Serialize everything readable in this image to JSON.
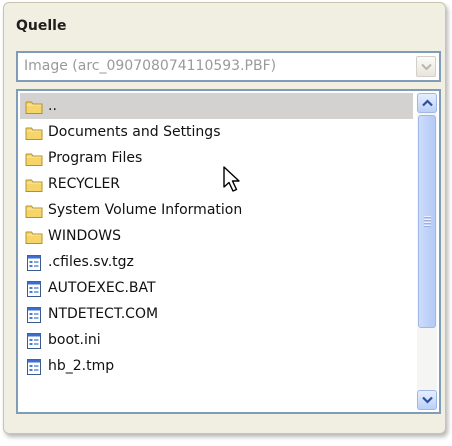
{
  "source_group": {
    "title": "Quelle",
    "combo_value": "Image (arc_090708074110593.PBF)"
  },
  "file_list": {
    "items": [
      {
        "label": "..",
        "icon": "folder-icon",
        "selected": true
      },
      {
        "label": "Documents and Settings",
        "icon": "folder-icon"
      },
      {
        "label": "Program Files",
        "icon": "folder-icon"
      },
      {
        "label": "RECYCLER",
        "icon": "folder-icon"
      },
      {
        "label": "System Volume Information",
        "icon": "folder-icon"
      },
      {
        "label": "WINDOWS",
        "icon": "folder-icon"
      },
      {
        "label": ".cfiles.sv.tgz",
        "icon": "file-icon"
      },
      {
        "label": "AUTOEXEC.BAT",
        "icon": "file-icon"
      },
      {
        "label": "NTDETECT.COM",
        "icon": "file-icon"
      },
      {
        "label": "boot.ini",
        "icon": "file-icon"
      },
      {
        "label": "hb_2.tmp",
        "icon": "file-icon"
      }
    ],
    "scroll_position": 0.0
  },
  "colors": {
    "panel_bg": "#f1efe2",
    "border_blue": "#7f9db9",
    "selection_gray": "#d3d2d0",
    "folder_yellow": "#f5d56a",
    "scroll_blue": "#bfd2f8"
  }
}
